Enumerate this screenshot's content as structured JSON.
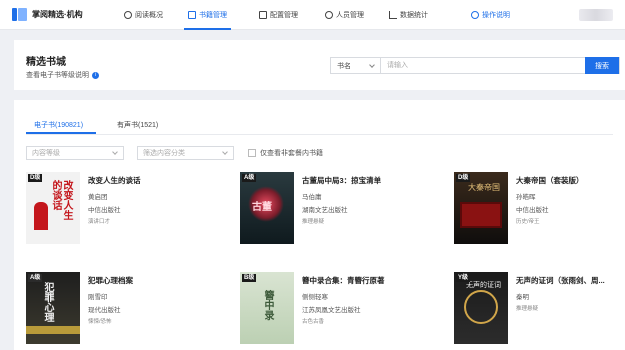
{
  "app": {
    "name": "掌阅精选·机构"
  },
  "nav": {
    "items": [
      "阅读概况",
      "书籍管理",
      "配置管理",
      "人员管理",
      "数据统计"
    ],
    "active": "书籍管理",
    "help": "操作说明"
  },
  "header": {
    "title": "精选书城",
    "subtitle": "查看电子书等级说明"
  },
  "search": {
    "field": "书名",
    "placeholder": "请输入",
    "button": "搜索"
  },
  "tabs": {
    "ebook": "电子书(190821)",
    "audio": "有声书(1521)"
  },
  "filters": {
    "grade_placeholder": "内容等级",
    "category_placeholder": "筛选内容分类",
    "only_unbooked": "仅查看非套餐内书籍"
  },
  "books": [
    {
      "badge": "D级",
      "title": "改变人生的谈话",
      "author": "黄启团",
      "publisher": "中信出版社",
      "tag": "演讲口才"
    },
    {
      "badge": "A级",
      "title": "古董局中局3：掠宝清单",
      "author": "马伯庸",
      "publisher": "湖南文艺出版社",
      "tag": "推理悬疑"
    },
    {
      "badge": "D级",
      "title": "大秦帝国（套装版）",
      "author": "孙皓晖",
      "publisher": "中信出版社",
      "tag": "历史/帝王"
    },
    {
      "badge": "A级",
      "title": "犯罪心理档案",
      "author": "刚雪印",
      "publisher": "现代出版社",
      "tag": "悚悚/恐怖"
    },
    {
      "badge": "B级",
      "title": "簪中录合集：青簪行原著",
      "author": "侧侧轻寒",
      "publisher": "江苏凤凰文艺出版社",
      "tag": "古色古香"
    },
    {
      "badge": "Y级",
      "title": "无声的证词（张雨剑、周...",
      "author": "秦明",
      "publisher": "",
      "tag": "推理悬疑"
    }
  ],
  "colors": {
    "accent": "#1e6fe8"
  }
}
